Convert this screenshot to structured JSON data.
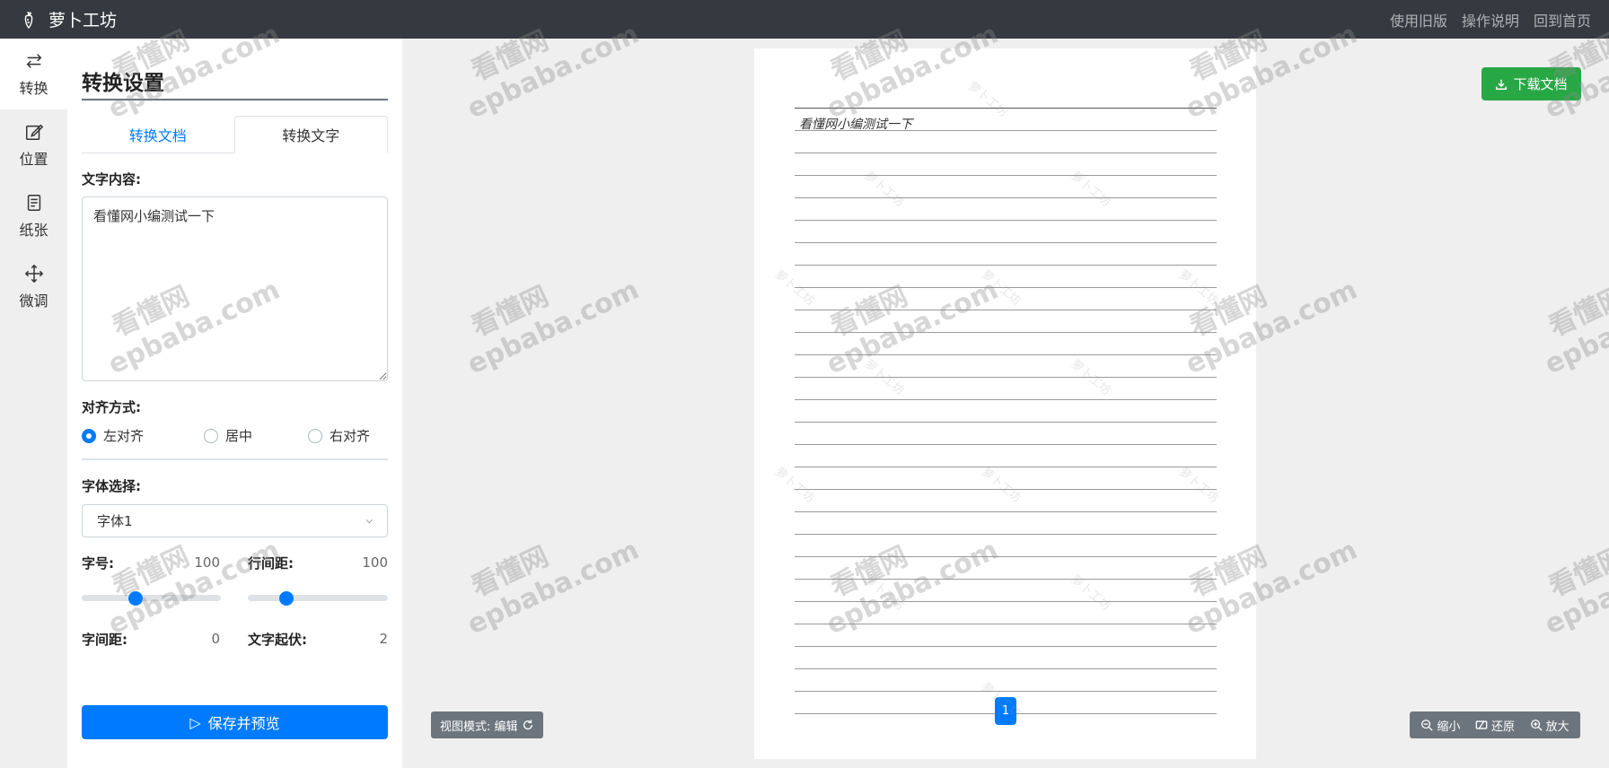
{
  "navbar": {
    "brand": "萝卜工坊",
    "links": [
      "使用旧版",
      "操作说明",
      "回到首页"
    ]
  },
  "sidebar": {
    "items": [
      {
        "label": "转换",
        "icon": "swap-icon",
        "active": true
      },
      {
        "label": "位置",
        "icon": "edit-icon",
        "active": false
      },
      {
        "label": "纸张",
        "icon": "document-icon",
        "active": false
      },
      {
        "label": "微调",
        "icon": "move-icon",
        "active": false
      }
    ]
  },
  "panel": {
    "title": "转换设置",
    "tabs": {
      "doc": "转换文档",
      "text": "转换文字"
    },
    "content_label": "文字内容:",
    "content_value": "看懂网小编测试一下",
    "align_label": "对齐方式:",
    "align_options": [
      "左对齐",
      "居中",
      "右对齐"
    ],
    "align_selected": 0,
    "font_label": "字体选择:",
    "font_value": "字体1",
    "size_label": "字号:",
    "size_value": "100",
    "line_label": "行间距:",
    "line_value": "100",
    "char_label": "字间距:",
    "char_value": "0",
    "wave_label": "文字起伏:",
    "wave_value": "2",
    "save_label": "保存并预览"
  },
  "preview": {
    "download_label": "下载文档",
    "paper_text": "看懂网小编测试一下",
    "page_number": "1",
    "view_mode_label": "视图模式: 编辑",
    "zoom": {
      "out": "缩小",
      "reset": "还原",
      "in": "放大"
    }
  },
  "watermarks": {
    "brand_mark": "看懂网",
    "domain_mark": "epbaba.com",
    "page_mark": "萝卜工坊"
  },
  "colors": {
    "navbar": "#343a40",
    "primary": "#007bff",
    "success": "#28a745",
    "secondary": "#6c757d"
  }
}
